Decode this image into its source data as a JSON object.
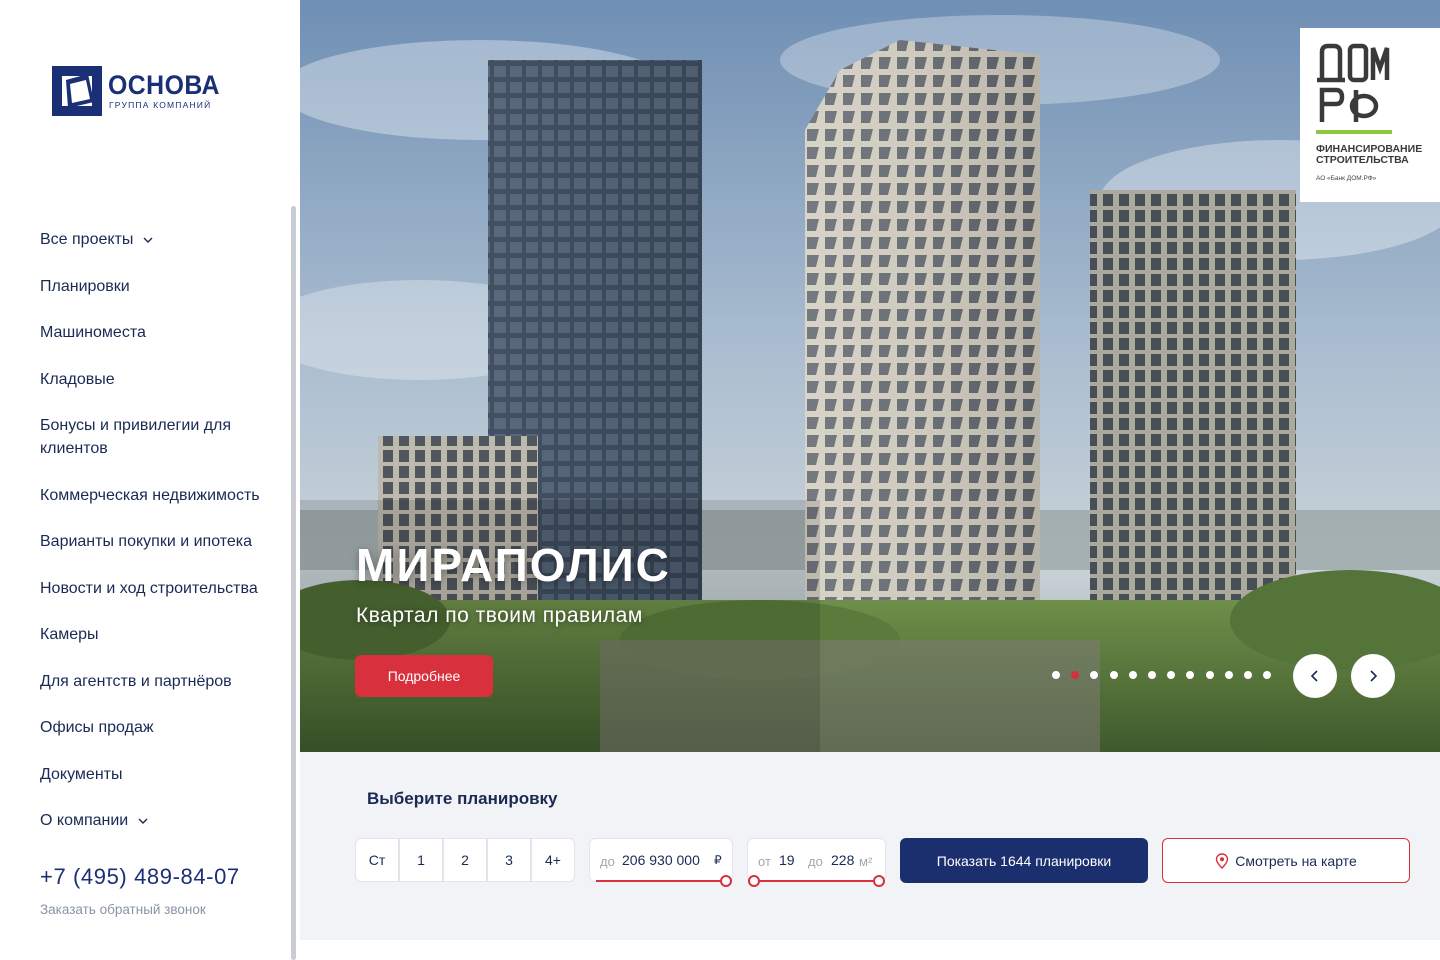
{
  "logo": {
    "title": "ОСНОВА",
    "subtitle": "ГРУППА КОМПАНИЙ"
  },
  "nav": [
    {
      "label": "Все проекты",
      "has_dropdown": true
    },
    {
      "label": "Планировки"
    },
    {
      "label": "Машиноместа"
    },
    {
      "label": "Кладовые"
    },
    {
      "label": "Бонусы и привилегии для клиентов"
    },
    {
      "label": "Коммерческая недвижимость"
    },
    {
      "label": "Варианты покупки и ипотека"
    },
    {
      "label": "Новости и ход строительства"
    },
    {
      "label": "Камеры"
    },
    {
      "label": "Для агентств и партнёров"
    },
    {
      "label": "Офисы продаж"
    },
    {
      "label": "Документы"
    },
    {
      "label": "О компании",
      "has_dropdown": true
    }
  ],
  "contact": {
    "phone": "+7 (495) 489-84-07",
    "callback": "Заказать обратный звонок"
  },
  "hero": {
    "title": "МИРАПОЛИС",
    "subtitle": "Квартал по твоим правилам",
    "button": "Подробнее",
    "slides_total": 12,
    "active_slide": 2
  },
  "badge": {
    "logo_top": "ДОМ",
    "logo_bottom": "РФ",
    "text": "ФИНАНСИРОВАНИЕ СТРОИТЕЛЬСТВА",
    "small": "АО «Банк ДОМ.РФ»"
  },
  "filter": {
    "title": "Выберите планировку",
    "rooms": [
      "Ст",
      "1",
      "2",
      "3",
      "4+"
    ],
    "price": {
      "prefix": "до",
      "value": "206 930 000",
      "unit": "₽"
    },
    "area": {
      "from_label": "от",
      "from": "19",
      "to_label": "до",
      "to": "228",
      "unit": "м²"
    },
    "show_button": "Показать 1644 планировки",
    "map_button": "Смотреть на карте"
  },
  "colors": {
    "brand": "#1b2f77",
    "accent": "#d8303c",
    "panel": "#f2f3f6"
  }
}
